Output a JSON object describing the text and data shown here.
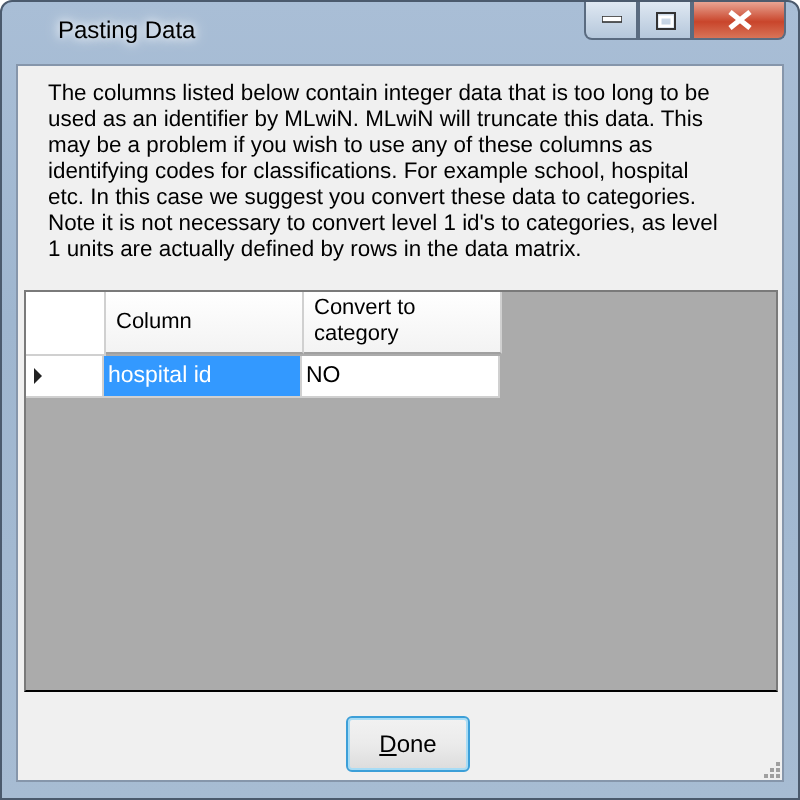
{
  "window": {
    "title": "Pasting Data"
  },
  "message": "The columns listed below contain integer data that is too long to be used as an identifier by MLwiN. MLwiN will truncate this data. This may be a problem if you wish to use any of these columns as identifying codes for classifications. For example school, hospital etc. In this case we suggest you convert these data to categories. Note it is not necessary to convert level 1 id's to categories, as level 1 units are actually defined by rows in the data matrix.",
  "table": {
    "columns": [
      "Column",
      "Convert to category"
    ],
    "rows": [
      {
        "current": true,
        "cells": [
          {
            "text": "hospital id",
            "selected": true
          },
          {
            "text": "NO",
            "selected": false
          }
        ]
      }
    ]
  },
  "buttons": [
    {
      "label": "Done",
      "default": true
    }
  ]
}
